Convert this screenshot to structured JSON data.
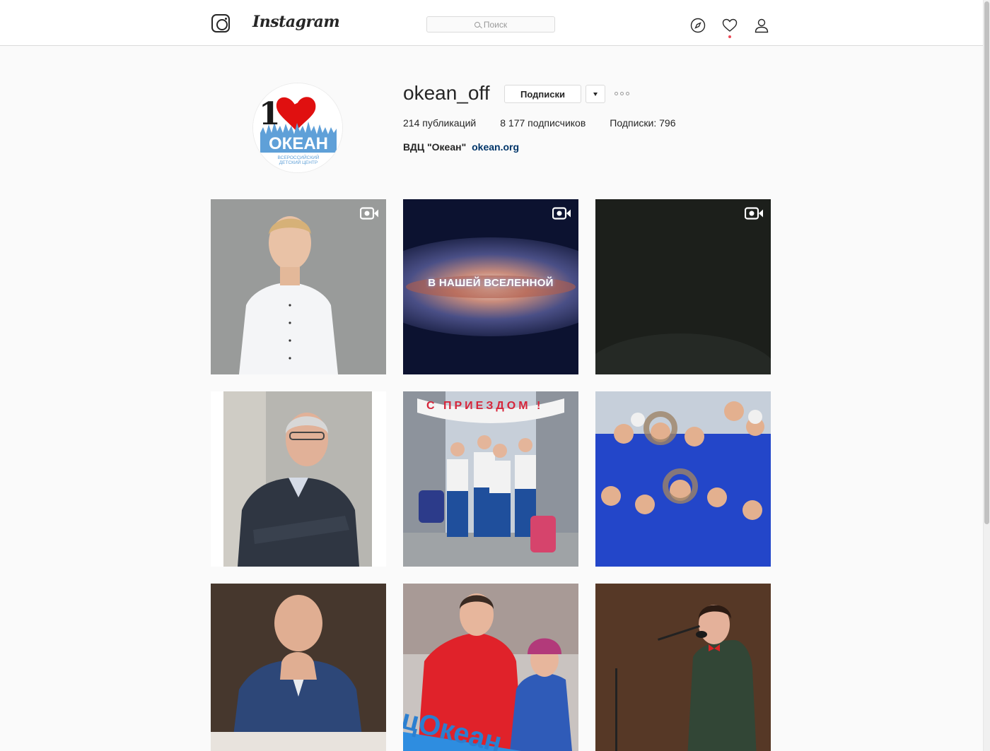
{
  "nav": {
    "wordmark": "Instagram",
    "search_placeholder": "Поиск",
    "icons": [
      "instagram-glyph-icon",
      "compass-icon",
      "heart-icon",
      "user-icon"
    ],
    "activity_dot_color": "#ed4956"
  },
  "profile": {
    "username": "okean_off",
    "follow_button": "Подписки",
    "stats": {
      "posts": "214 публикаций",
      "followers": "8 177 подписчиков",
      "following": "Подписки: 796"
    },
    "bio_name": "ВДЦ \"Океан\"",
    "bio_link": "okean.org",
    "avatar_logo_text": {
      "number": "1",
      "name": "ОКЕАН",
      "sub1": "ВСЕРОССИЙСКИЙ",
      "sub2": "ДЕТСКИЙ ЦЕНТР"
    }
  },
  "posts": [
    {
      "kind": "video",
      "overlay": ""
    },
    {
      "kind": "video",
      "overlay": "В НАШЕЙ ВСЕЛЕННОЙ"
    },
    {
      "kind": "video",
      "overlay": ""
    },
    {
      "kind": "photo",
      "overlay": ""
    },
    {
      "kind": "photo",
      "overlay": "С ПРИЕЗДОМ !"
    },
    {
      "kind": "photo",
      "overlay": ""
    },
    {
      "kind": "photo",
      "overlay": ""
    },
    {
      "kind": "photo",
      "overlay": "цОкеан"
    },
    {
      "kind": "photo",
      "overlay": ""
    }
  ],
  "colors": {
    "link": "#003569",
    "border": "#dbdbdb",
    "background": "#fafafa"
  }
}
